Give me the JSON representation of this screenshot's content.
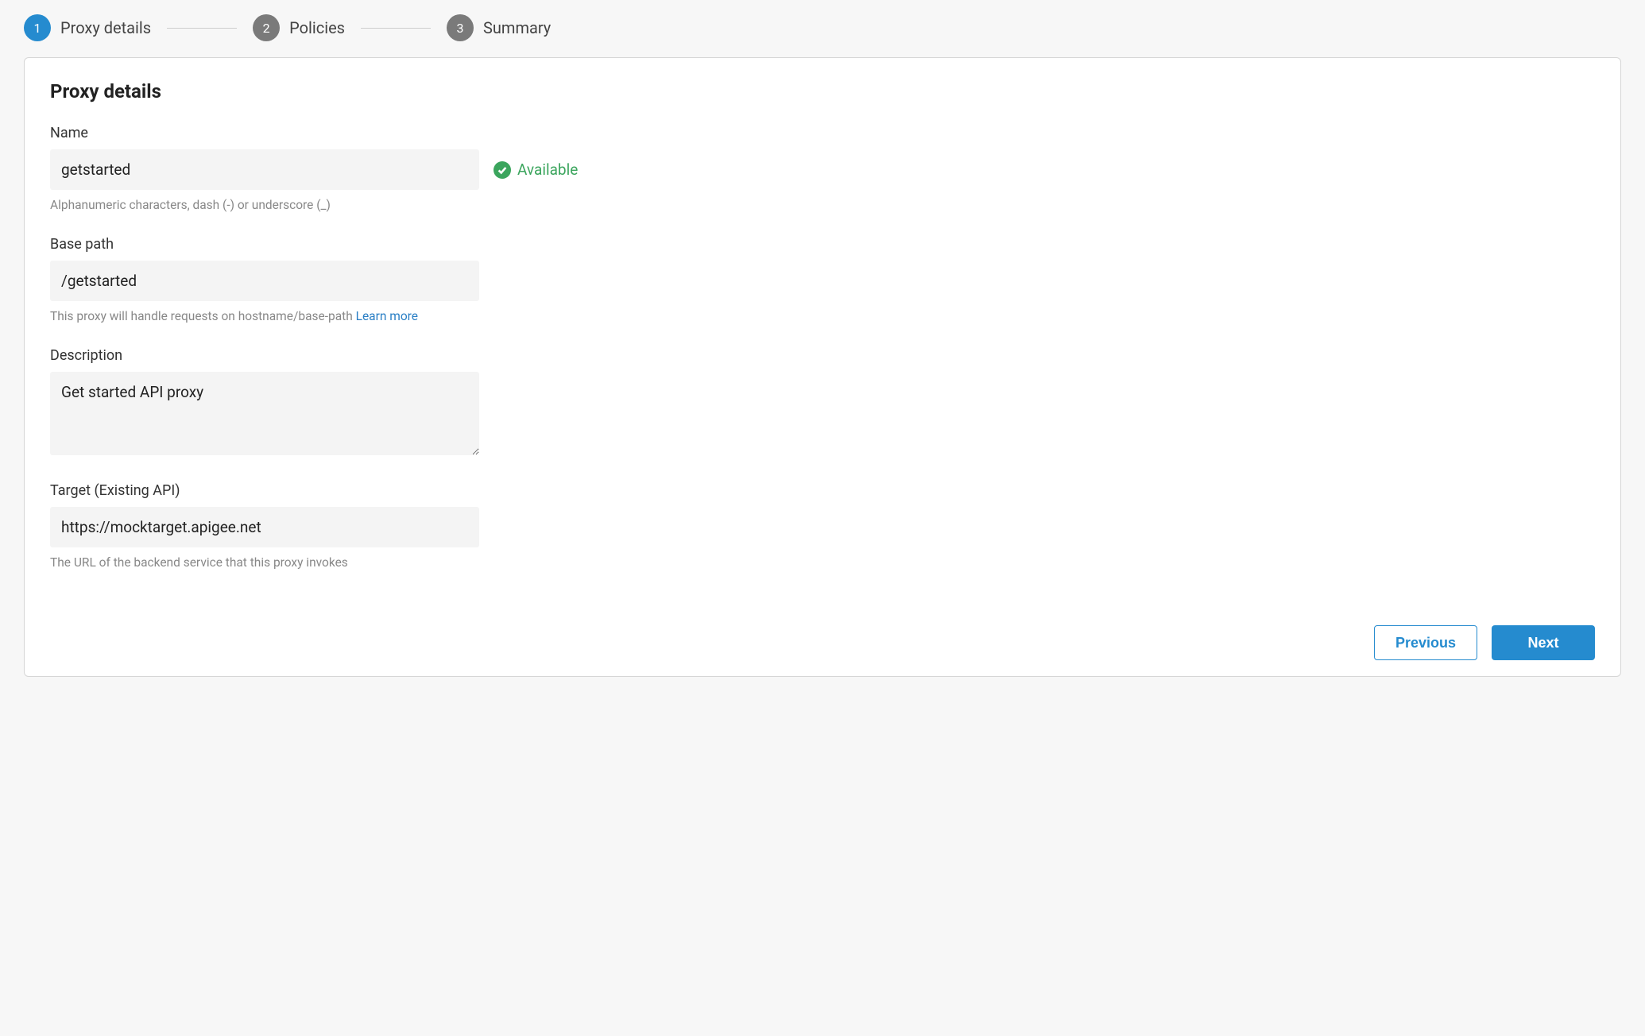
{
  "stepper": {
    "steps": [
      {
        "number": "1",
        "label": "Proxy details",
        "active": true
      },
      {
        "number": "2",
        "label": "Policies",
        "active": false
      },
      {
        "number": "3",
        "label": "Summary",
        "active": false
      }
    ]
  },
  "card": {
    "title": "Proxy details"
  },
  "form": {
    "name": {
      "label": "Name",
      "value": "getstarted",
      "help": "Alphanumeric characters, dash (-) or underscore (_)",
      "availability": "Available"
    },
    "basepath": {
      "label": "Base path",
      "value": "/getstarted",
      "help": "This proxy will handle requests on hostname/base-path ",
      "learn_more": "Learn more"
    },
    "description": {
      "label": "Description",
      "value": "Get started API proxy"
    },
    "target": {
      "label": "Target (Existing API)",
      "value": "https://mocktarget.apigee.net",
      "help": "The URL of the backend service that this proxy invokes"
    }
  },
  "footer": {
    "previous": "Previous",
    "next": "Next"
  }
}
